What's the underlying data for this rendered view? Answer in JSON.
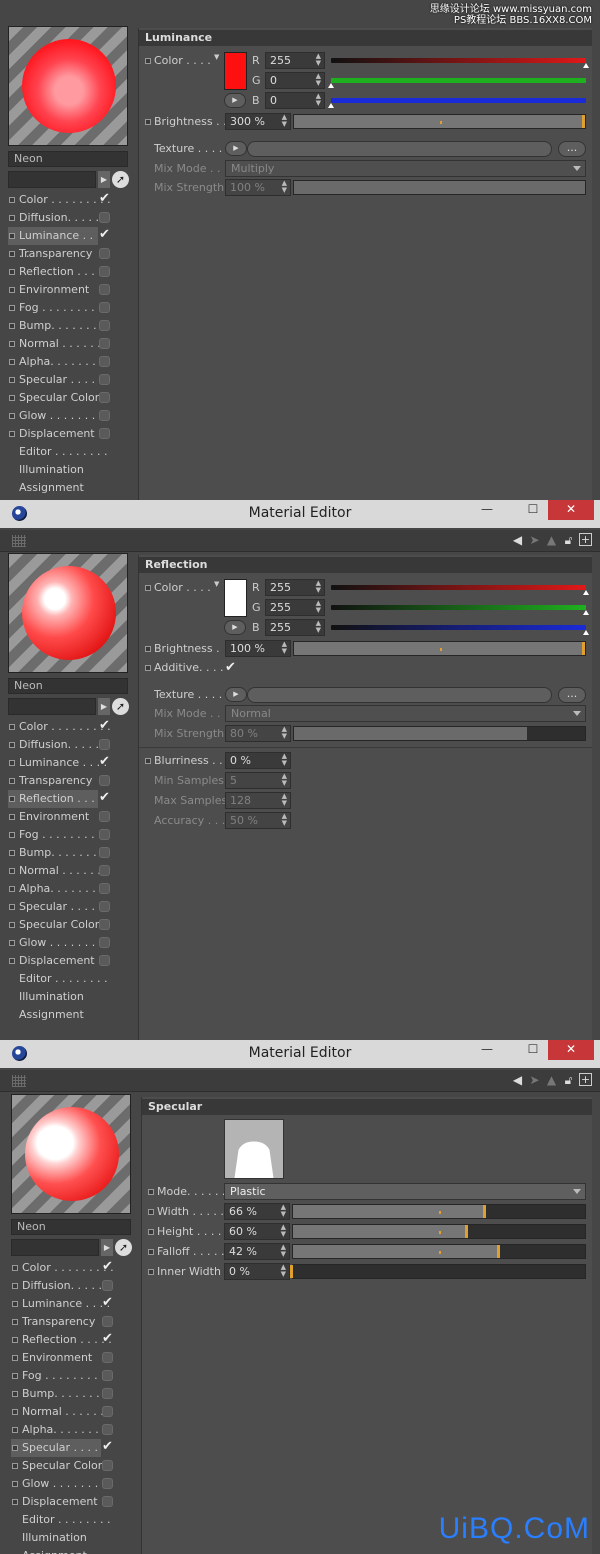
{
  "watermark": {
    "top_line1": "思缘设计论坛 www.missyuan.com",
    "top_line2": "PS教程论坛 BBS.16XX8.COM",
    "bottom": "UiBQ.CoM"
  },
  "window": {
    "title": "Material Editor",
    "minimize": "—",
    "maximize": "☐",
    "close": "✕"
  },
  "toolbar_icons": [
    "back-arrow-icon",
    "forward-arrow-icon",
    "up-arrow-icon",
    "lock-icon",
    "new-panel-icon"
  ],
  "material_name": "Neon",
  "channels": [
    {
      "label": "Color . . . . . . . . .",
      "key": "color"
    },
    {
      "label": "Diffusion. . . . . .",
      "key": "diffusion"
    },
    {
      "label": "Luminance . . . .",
      "key": "luminance"
    },
    {
      "label": "Transparency",
      "key": "transparency"
    },
    {
      "label": "Reflection . . . . .",
      "key": "reflection"
    },
    {
      "label": "Environment",
      "key": "environment"
    },
    {
      "label": "Fog . . . . . . . . . .",
      "key": "fog"
    },
    {
      "label": "Bump. . . . . . . . .",
      "key": "bump"
    },
    {
      "label": "Normal . . . . . . .",
      "key": "normal"
    },
    {
      "label": "Alpha. . . . . . . . .",
      "key": "alpha"
    },
    {
      "label": "Specular . . . . . .",
      "key": "specular"
    },
    {
      "label": "Specular Color",
      "key": "specular_color"
    },
    {
      "label": "Glow . . . . . . . . .",
      "key": "glow"
    },
    {
      "label": "Displacement",
      "key": "displacement"
    },
    {
      "label": "Editor . . . . . . . .",
      "key": "editor"
    },
    {
      "label": "Illumination",
      "key": "illumination"
    },
    {
      "label": "Assignment",
      "key": "assignment"
    }
  ],
  "check_mark": "✔",
  "panel1": {
    "enabled": [
      "color",
      "luminance"
    ],
    "selected": "luminance",
    "section": "Luminance",
    "color_label": "Color . . . .",
    "color_hex": "#ff1010",
    "r_label": "R",
    "g_label": "G",
    "b_label": "B",
    "r": "255",
    "g": "0",
    "b": "0",
    "r_level": 1.0,
    "g_level": 0.0,
    "b_level": 0.0,
    "brightness_label": "Brightness . .",
    "brightness": "300 %",
    "brightness_level": 1.0,
    "texture_label": "Texture . . . .",
    "dots": "...",
    "mixmode_label": "Mix Mode . .",
    "mixmode": "Multiply",
    "mixstrength_label": "Mix Strength",
    "mixstrength": "100 %",
    "mixstrength_level": 1.0
  },
  "panel2": {
    "enabled": [
      "color",
      "luminance",
      "reflection"
    ],
    "selected": "reflection",
    "section": "Reflection",
    "color_label": "Color . . . .",
    "color_hex": "#ffffff",
    "r_label": "R",
    "g_label": "G",
    "b_label": "B",
    "r": "255",
    "g": "255",
    "b": "255",
    "r_level": 1.0,
    "g_level": 1.0,
    "b_level": 1.0,
    "brightness_label": "Brightness .",
    "brightness": "100 %",
    "brightness_level": 1.0,
    "additive_label": "Additive. . . .",
    "texture_label": "Texture . . . .",
    "dots": "...",
    "mixmode_label": "Mix Mode . .",
    "mixmode": "Normal",
    "mixstrength_label": "Mix Strength",
    "mixstrength": "80 %",
    "mixstrength_level": 0.8,
    "blurriness_label": "Blurriness . .",
    "blurriness": "0 %",
    "minsamples_label": "Min Samples",
    "minsamples": "5",
    "maxsamples_label": "Max Samples",
    "maxsamples": "128",
    "accuracy_label": "Accuracy . . .",
    "accuracy": "50 %"
  },
  "panel3": {
    "enabled": [
      "color",
      "luminance",
      "reflection",
      "specular"
    ],
    "selected": "specular",
    "section": "Specular",
    "mode_label": "Mode. . . . . . .",
    "mode": "Plastic",
    "width_label": "Width . . . . .",
    "width": "66 %",
    "width_level": 0.66,
    "height_label": "Height . . . . .",
    "height": "60 %",
    "height_level": 0.6,
    "falloff_label": "Falloff . . . . .",
    "falloff": "42 %",
    "falloff_level": 0.71,
    "innerwidth_label": "Inner Width",
    "innerwidth": "0 %",
    "innerwidth_level": 0.0
  },
  "colors": {
    "accent": "#e0a030",
    "red_bar": "#e01818",
    "green_bar": "#1fb01f",
    "blue_bar": "#1a2ad8"
  }
}
